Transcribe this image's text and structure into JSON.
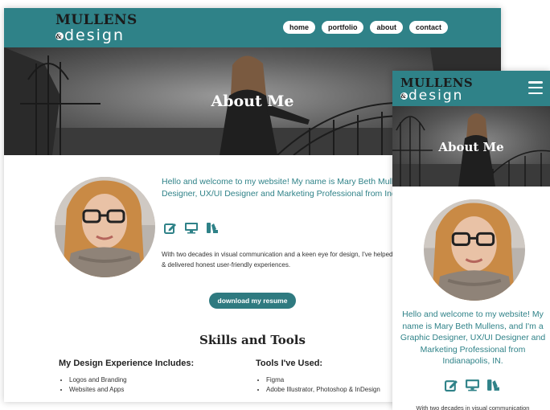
{
  "brand": {
    "logo_top": "MULLENS",
    "logo_amp": "&",
    "logo_bottom": "design"
  },
  "nav": {
    "items": [
      {
        "label": "home"
      },
      {
        "label": "portfolio"
      },
      {
        "label": "about"
      },
      {
        "label": "contact"
      }
    ]
  },
  "hero": {
    "title": "About Me"
  },
  "about": {
    "intro_desktop": "Hello and welcome to my website! My name is Mary Beth Mullens, and I'm a Graphic Designer, UX/UI Designer and Marketing Professional from Indianapolis, IN.",
    "intro_mobile": "Hello and welcome to my website! My name is Mary Beth Mullens, and I'm a Graphic Designer, UX/UI Designer and Marketing Professional from Indianapolis, IN.",
    "paragraph": "With two decades in visual communication and a keen eye for design, I've helped many brands, ensured products shine, & delivered honest user-friendly experiences.",
    "mobile_paragraph": "With two decades in visual communication",
    "icons": [
      "edit-icon",
      "desktop-icon",
      "swatches-icon"
    ],
    "resume_button": "download my resume"
  },
  "skills": {
    "title": "Skills and Tools",
    "experience_heading": "My Design Experience Includes:",
    "experience_items": [
      "Logos and Branding",
      "Websites and Apps"
    ],
    "tools_heading": "Tools I've Used:",
    "tools_items": [
      "Figma",
      "Adobe Illustrator, Photoshop & InDesign"
    ]
  },
  "colors": {
    "teal": "#2f8288",
    "button": "#2f7a80",
    "text_teal": "#2f8288"
  }
}
